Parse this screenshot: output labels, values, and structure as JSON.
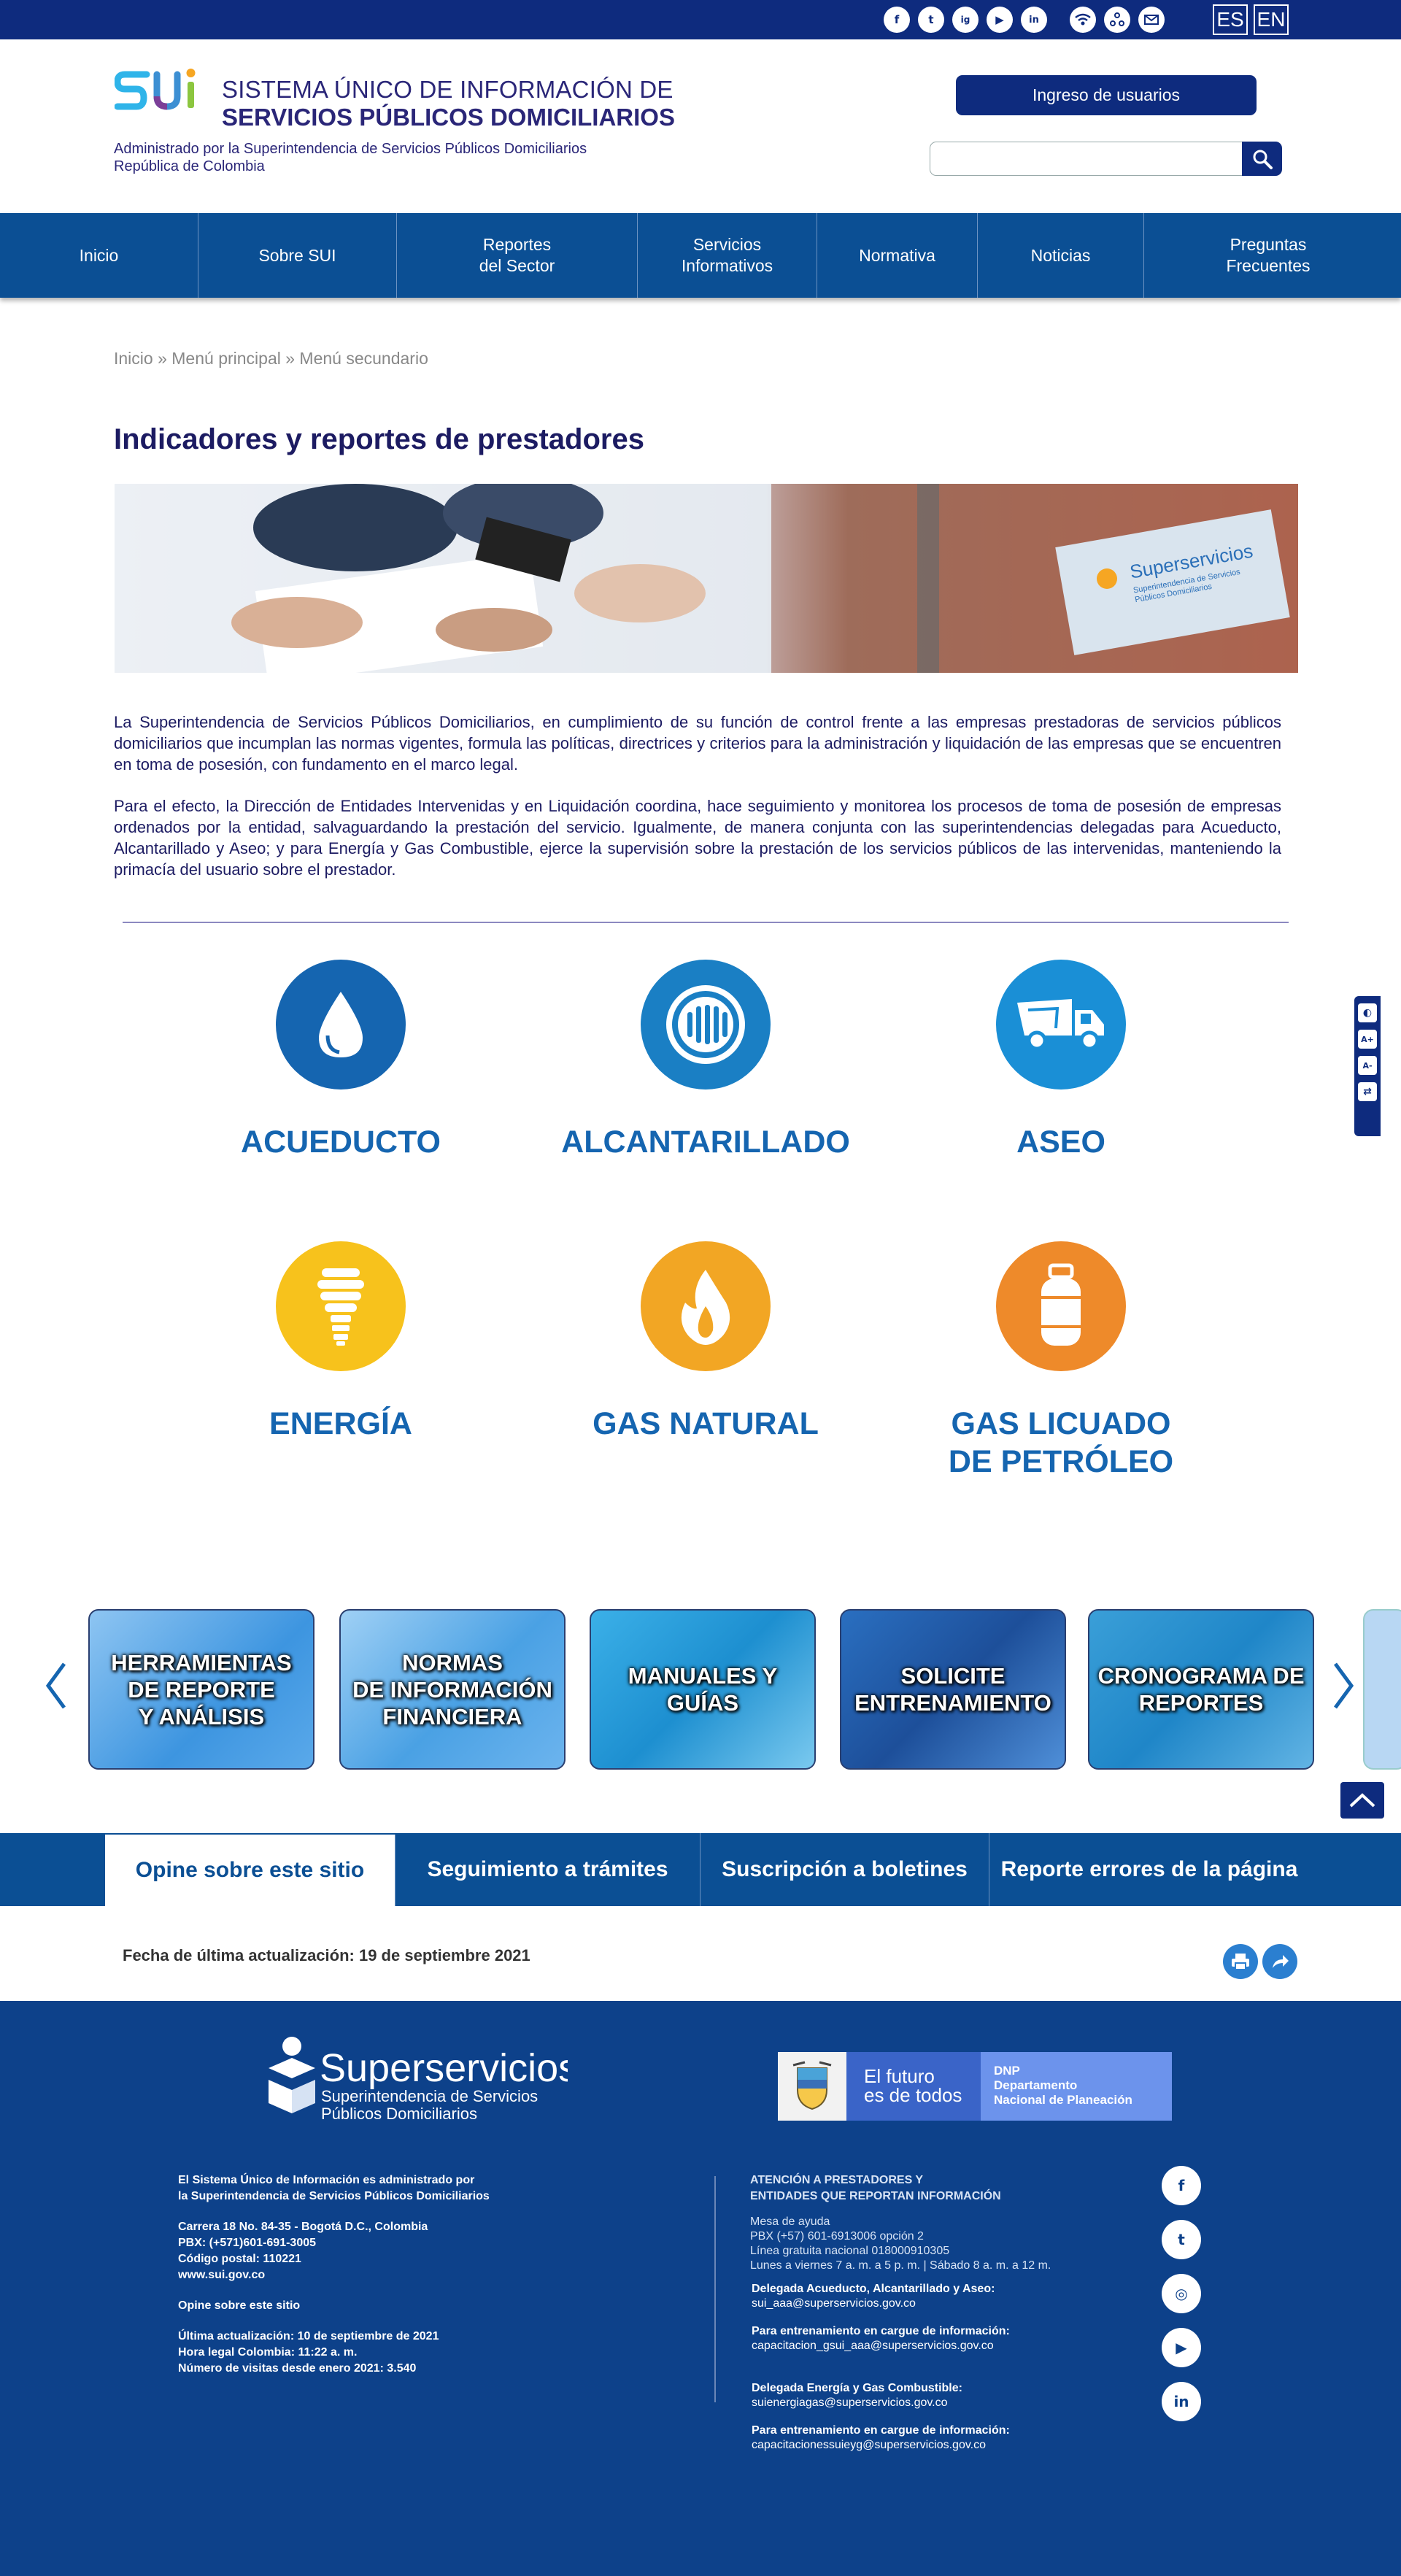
{
  "topbar": {
    "social": [
      "f",
      "t",
      "ig",
      "▶",
      "in"
    ],
    "access": [
      "wifi-icon",
      "accessibility-icon",
      "mail-icon"
    ],
    "lang": [
      "ES",
      "EN"
    ]
  },
  "header": {
    "logo_line1": "SISTEMA ÚNICO DE INFORMACIÓN DE",
    "logo_line2": "SERVICIOS PÚBLICOS DOMICILIARIOS",
    "admin_line1": "Administrado por la Superintendencia de Servicios Públicos Domiciliarios",
    "admin_line2": "República de Colombia",
    "login": "Ingreso de usuarios",
    "search_placeholder": ""
  },
  "nav": [
    {
      "label": "Inicio"
    },
    {
      "label": "Sobre SUI"
    },
    {
      "label": "Reportes\ndel Sector"
    },
    {
      "label": "Servicios\nInformativos"
    },
    {
      "label": "Normativa"
    },
    {
      "label": "Noticias"
    },
    {
      "label": "Preguntas\nFrecuentes"
    }
  ],
  "breadcrumb": "Inicio » Menú principal » Menú secundario",
  "title": "Indicadores y reportes de prestadores",
  "banner_sign": {
    "brand": "Superservicios",
    "sub1": "Superintendencia de Servicios",
    "sub2": "Públicos Domiciliarios"
  },
  "paragraphs": [
    "La Superintendencia de Servicios Públicos Domiciliarios, en cumplimiento de su función de control frente a las empresas prestadoras de servicios públicos domiciliarios que incumplan las normas vigentes, formula las políticas, directrices y criterios para la administración y liquidación de las empresas que se encuentren en toma de posesión, con fundamento en el marco legal.",
    "Para el efecto, la Dirección de Entidades Intervenidas y en Liquidación coordina, hace seguimiento y monitorea los procesos de toma de posesión de empresas ordenados por la entidad, salvaguardando la prestación del servicio. Igualmente, de manera conjunta con las superintendencias delegadas para Acueducto, Alcantarillado y Aseo; y para Energía y Gas Combustible, ejerce la supervisión sobre la prestación de los servicios públicos de las intervenidas, manteniendo la primacía del usuario sobre el prestador."
  ],
  "services": [
    {
      "label": "ACUEDUCTO",
      "color": "#1565b0",
      "icon": "water-drop-icon"
    },
    {
      "label": "ALCANTARILLADO",
      "color": "#1a7fc4",
      "icon": "sewer-grate-icon"
    },
    {
      "label": "ASEO",
      "color": "#1a8fd6",
      "icon": "garbage-truck-icon"
    },
    {
      "label": "ENERGÍA",
      "color": "#f7c21c",
      "icon": "light-bulb-icon"
    },
    {
      "label": "GAS NATURAL",
      "color": "#f2a624",
      "icon": "flame-icon"
    },
    {
      "label": "GAS LICUADO\nDE PETRÓLEO",
      "color": "#ee8a2a",
      "icon": "gas-cylinder-icon"
    }
  ],
  "side_tools": [
    "◐",
    "A+",
    "A-",
    "⇄"
  ],
  "carousel": [
    {
      "label": "HERRAMIENTAS\nDE REPORTE\nY ANÁLISIS"
    },
    {
      "label": "NORMAS\nDE INFORMACIÓN\nFINANCIERA"
    },
    {
      "label": "MANUALES Y\nGUÍAS"
    },
    {
      "label": "SOLICITE\nENTRENAMIENTO"
    },
    {
      "label": "CRONOGRAMA DE\nREPORTES"
    }
  ],
  "tabs": [
    {
      "label": "Opine sobre este sitio"
    },
    {
      "label": "Seguimiento a trámites"
    },
    {
      "label": "Suscripción a boletines"
    },
    {
      "label": "Reporte errores de la página"
    }
  ],
  "last_update": "Fecha de última actualización: 19 de septiembre 2021",
  "footer": {
    "brand": "Superservicios",
    "brand_sub1": "Superintendencia de Servicios",
    "brand_sub2": "Públicos Domiciliarios",
    "dnp_slogan1": "El futuro",
    "dnp_slogan2": "es de todos",
    "dnp_name1": "DNP",
    "dnp_name2": "Departamento",
    "dnp_name3": "Nacional de Planeación",
    "left": [
      "El Sistema Único de Información es administrado por",
      "la Superintendencia de Servicios Públicos Domiciliarios",
      "",
      "Carrera 18 No. 84-35 - Bogotá D.C., Colombia",
      "PBX: (+571)601-691-3005",
      "Código postal: 110221",
      "www.sui.gov.co",
      "",
      "Opine sobre este sitio",
      "",
      "Última actualización: 10 de septiembre de 2021",
      "Hora legal Colombia: 11:22 a. m.",
      "Número de visitas desde enero 2021: 3.540"
    ],
    "right_title1": "ATENCIÓN A PRESTADORES Y",
    "right_title2": "ENTIDADES QUE REPORTAN INFORMACIÓN",
    "help": [
      "Mesa de ayuda",
      "PBX (+57) 601-6913006 opción 2",
      "Línea gratuita nacional 018000910305",
      "Lunes a viernes 7 a. m. a 5 p. m. | Sábado 8 a. m. a 12 m."
    ],
    "contacts": [
      {
        "title": "Delegada Acueducto, Alcantarillado y Aseo:",
        "email": "sui_aaa@superservicios.gov.co"
      },
      {
        "title": "Para entrenamiento en cargue de información:",
        "email": "capacitacion_gsui_aaa@superservicios.gov.co"
      },
      {
        "title": "Delegada Energía y Gas Combustible:",
        "email": "suienergiagas@superservicios.gov.co"
      },
      {
        "title": "Para entrenamiento en cargue de información:",
        "email": "capacitacionessuieyg@superservicios.gov.co"
      }
    ],
    "social": [
      "f",
      "t",
      "◎",
      "▶",
      "in"
    ]
  }
}
